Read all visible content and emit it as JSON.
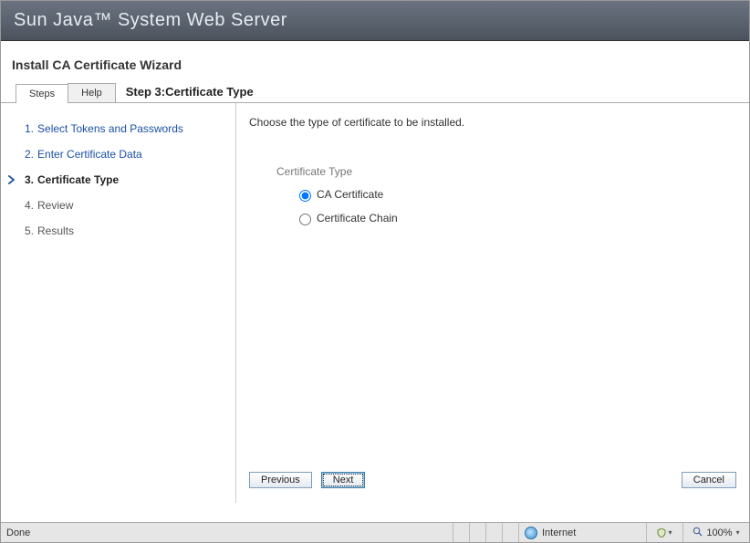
{
  "app_title": "Sun Java™ System Web Server",
  "wizard_title": "Install CA Certificate Wizard",
  "tabs": {
    "steps": "Steps",
    "help": "Help"
  },
  "step_header": "Step 3:Certificate Type",
  "steps": [
    {
      "num": "1.",
      "label": "Select Tokens and Passwords",
      "state": "link"
    },
    {
      "num": "2.",
      "label": "Enter Certificate Data",
      "state": "link"
    },
    {
      "num": "3.",
      "label": "Certificate Type",
      "state": "current"
    },
    {
      "num": "4.",
      "label": "Review",
      "state": "future"
    },
    {
      "num": "5.",
      "label": "Results",
      "state": "future"
    }
  ],
  "instruction": "Choose the type of certificate to be installed.",
  "group_label": "Certificate Type",
  "options": {
    "ca": "CA Certificate",
    "chain": "Certificate Chain"
  },
  "selected_option": "ca",
  "buttons": {
    "previous": "Previous",
    "next": "Next",
    "cancel": "Cancel"
  },
  "statusbar": {
    "done": "Done",
    "zone": "Internet",
    "zoom": "100%"
  }
}
